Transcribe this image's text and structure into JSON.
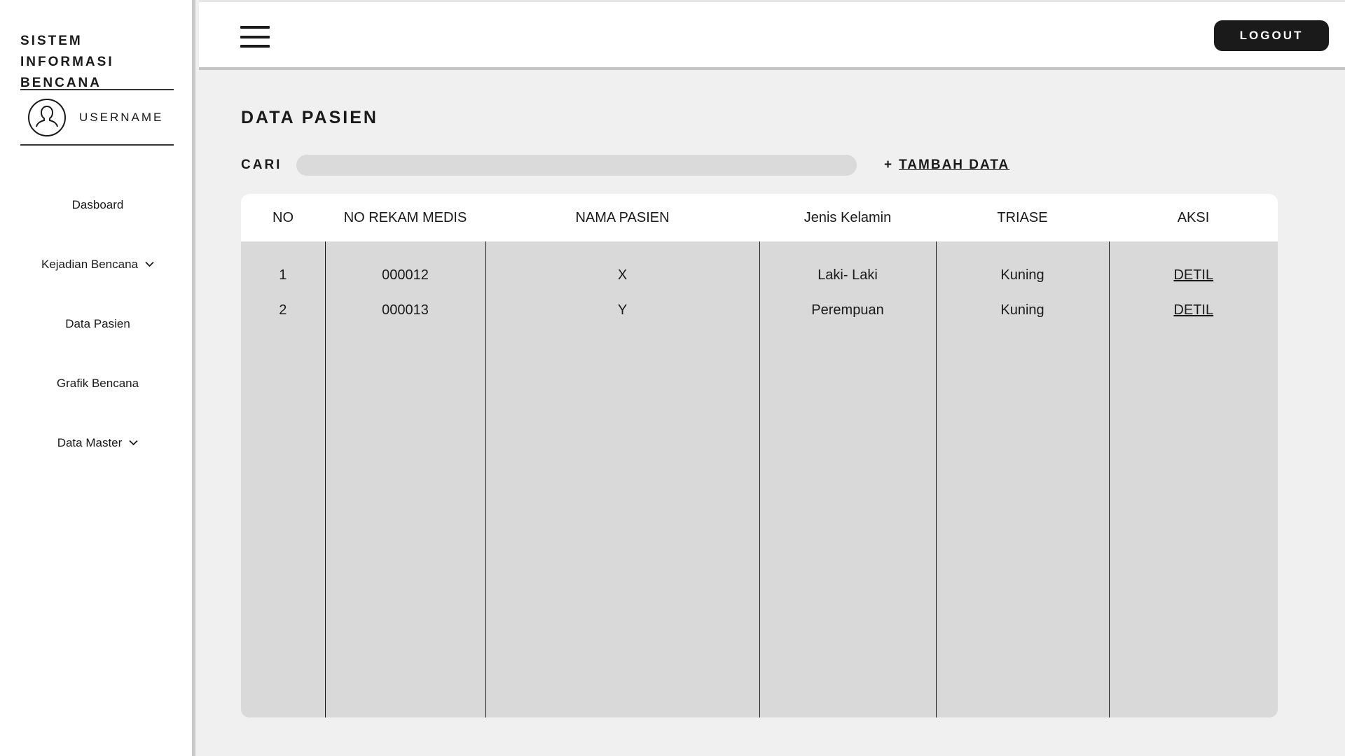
{
  "sidebar": {
    "brand_line1": "SISTEM INFORMASI",
    "brand_line2": "BENCANA",
    "username": "USERNAME",
    "items": [
      {
        "label": "Dasboard",
        "has_chevron": false
      },
      {
        "label": "Kejadian Bencana",
        "has_chevron": true
      },
      {
        "label": "Data Pasien",
        "has_chevron": false
      },
      {
        "label": "Grafik Bencana",
        "has_chevron": false
      },
      {
        "label": "Data Master",
        "has_chevron": true
      }
    ]
  },
  "header": {
    "logout_label": "LOGOUT"
  },
  "main": {
    "title": "DATA PASIEN",
    "search_label": "CARI",
    "search_value": "",
    "add_label": "TAMBAH DATA",
    "add_prefix": "+",
    "table": {
      "columns": [
        "NO",
        "NO REKAM MEDIS",
        "NAMA PASIEN",
        "Jenis Kelamin",
        "TRIASE",
        "AKSI"
      ],
      "rows": [
        {
          "no": "1",
          "rekam_medis": "000012",
          "nama": "X",
          "jenis_kelamin": "Laki- Laki",
          "triase": "Kuning",
          "aksi": "DETIL"
        },
        {
          "no": "2",
          "rekam_medis": "000013",
          "nama": "Y",
          "jenis_kelamin": "Perempuan",
          "triase": "Kuning",
          "aksi": "DETIL"
        }
      ]
    }
  },
  "colors": {
    "sidebar_bg": "#ffffff",
    "page_bg": "#f0f0f0",
    "table_body_bg": "#d9d9d9",
    "logout_bg": "#1a1a1a",
    "text": "#1a1a1a"
  }
}
